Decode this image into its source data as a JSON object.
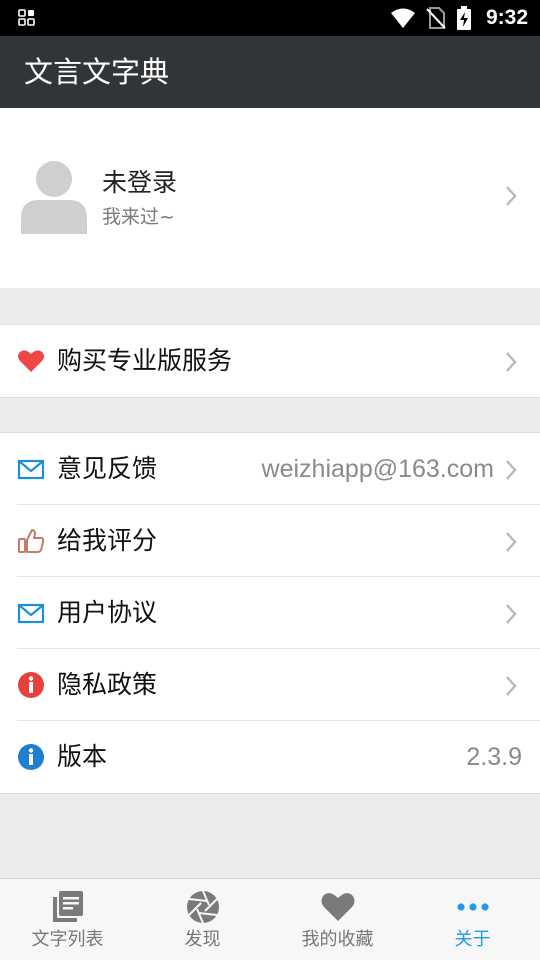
{
  "status_bar": {
    "time": "9:32",
    "icons": [
      "grid-icon",
      "wifi-icon",
      "no-sim-icon",
      "battery-charging-icon"
    ]
  },
  "app_bar": {
    "title": "文言文字典"
  },
  "profile": {
    "name": "未登录",
    "subtitle": "我来过~",
    "avatar_icon": "user-placeholder-icon"
  },
  "pro_group": {
    "items": [
      {
        "label": "购买专业版服务",
        "icon": "heart-icon",
        "icon_color": "#f04646"
      }
    ]
  },
  "menu": {
    "items": [
      {
        "label": "意见反馈",
        "value": "weizhiapp@163.com",
        "icon": "mail-icon",
        "icon_color": "#1e8ed6"
      },
      {
        "label": "给我评分",
        "value": "",
        "icon": "thumbs-up-icon",
        "icon_color": "#c77b6b"
      },
      {
        "label": "用户协议",
        "value": "",
        "icon": "mail-icon",
        "icon_color": "#1e8ed6"
      },
      {
        "label": "隐私政策",
        "value": "",
        "icon": "info-icon",
        "icon_color": "#e8403a"
      },
      {
        "label": "版本",
        "value": "2.3.9",
        "icon": "info-icon",
        "icon_color": "#1e7fd0"
      }
    ]
  },
  "bottom_nav": {
    "tabs": [
      {
        "label": "文字列表",
        "icon": "book-list-icon",
        "active": false
      },
      {
        "label": "发现",
        "icon": "aperture-icon",
        "active": false
      },
      {
        "label": "我的收藏",
        "icon": "heart-icon",
        "active": false
      },
      {
        "label": "关于",
        "icon": "more-dots-icon",
        "active": true
      }
    ],
    "active_color": "#1e9bf0"
  }
}
